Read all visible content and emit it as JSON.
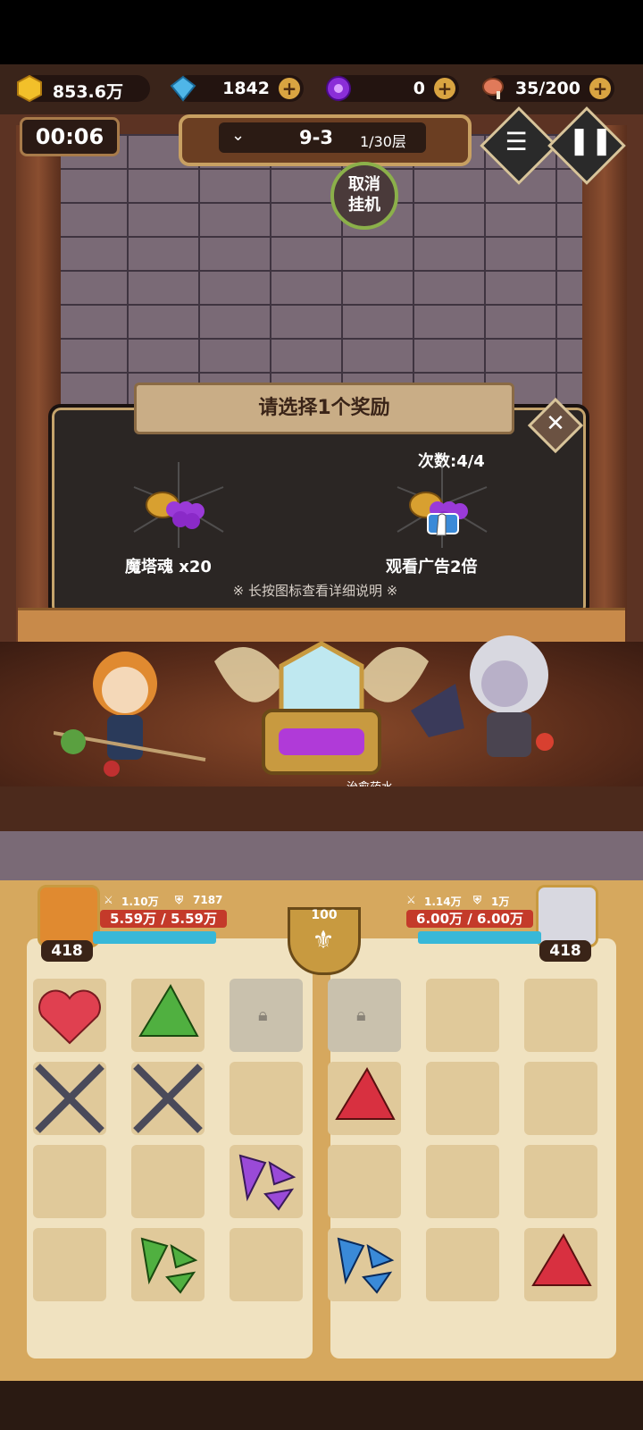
{
  "resources": {
    "gold": "853.6万",
    "gems": "1842",
    "soul_orbs": "0",
    "stamina": "35/200"
  },
  "header": {
    "timer": "00:06",
    "stage": "9-3",
    "floor": "1/30层",
    "idle_button": "取消挂机"
  },
  "reward_panel": {
    "title": "请选择1个奖励",
    "count_label": "次数:4/4",
    "option1_label": "魔塔魂 x20",
    "option2_label": "观看广告2倍",
    "hint": "※ 长按图标查看详细说明 ※"
  },
  "arena": {
    "drop_label": "治愈药水"
  },
  "player": {
    "attack": "1.10万",
    "defense": "7187",
    "hp": "5.59万 / 5.59万",
    "level": "418"
  },
  "enemy": {
    "attack": "1.14万",
    "defense": "1万",
    "hp": "6.00万 / 6.00万",
    "level": "418"
  },
  "center_badge": "100",
  "colors": {
    "gold": "#f2c02a",
    "gem": "#4fb6e8",
    "soul": "#8a2ed8",
    "hp": "#c43a2a",
    "mana": "#38b8d8",
    "panel_border": "#c5a46c"
  }
}
